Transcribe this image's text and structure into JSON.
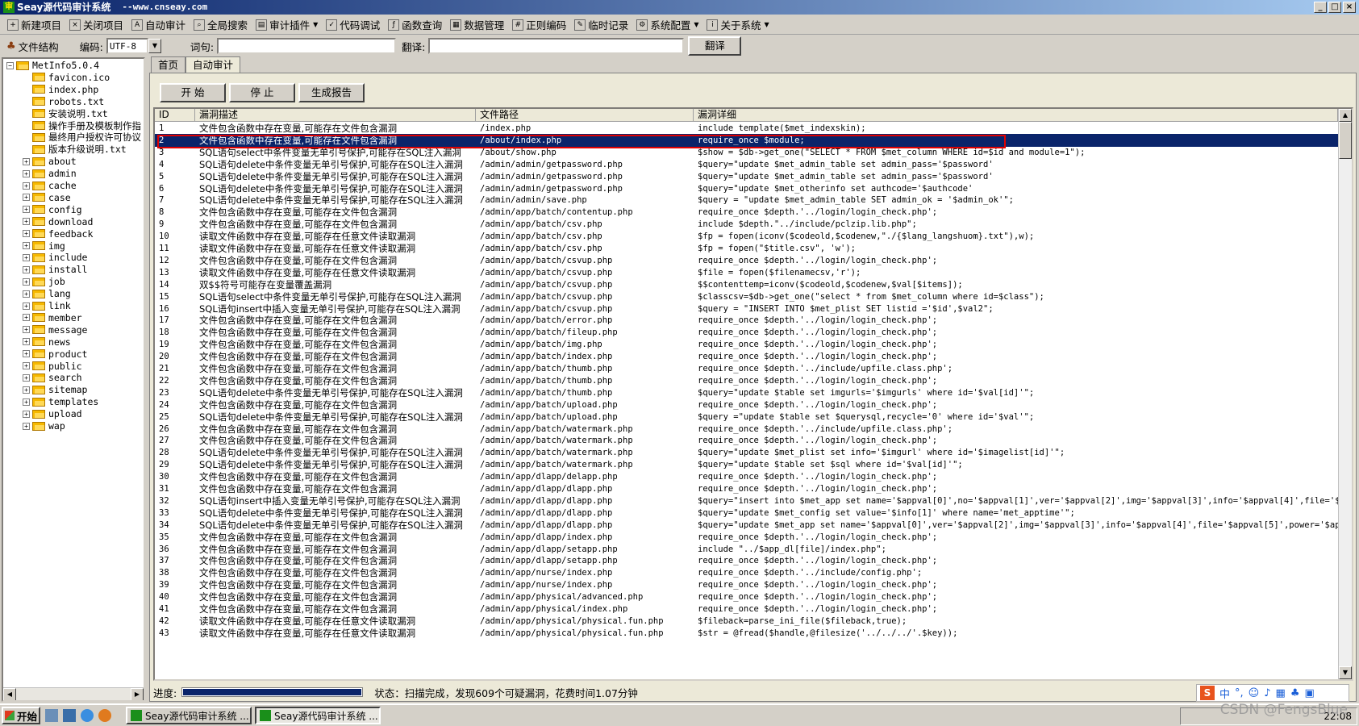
{
  "window": {
    "title": "Seay源代码审计系统",
    "subtitle": "--www.cnseay.com"
  },
  "toolbar": [
    {
      "label": "新建项目",
      "icon": "new-project-icon"
    },
    {
      "label": "关闭项目",
      "icon": "close-project-icon"
    },
    {
      "label": "自动审计",
      "icon": "auto-audit-icon"
    },
    {
      "label": "全局搜索",
      "icon": "search-icon"
    },
    {
      "label": "审计插件",
      "icon": "plugin-icon",
      "dropdown": true
    },
    {
      "label": "代码调试",
      "icon": "debug-icon"
    },
    {
      "label": "函数查询",
      "icon": "function-query-icon"
    },
    {
      "label": "数据管理",
      "icon": "data-manage-icon"
    },
    {
      "label": "正则编码",
      "icon": "regex-icon"
    },
    {
      "label": "临时记录",
      "icon": "note-icon"
    },
    {
      "label": "系统配置",
      "icon": "gear-icon",
      "dropdown": true
    },
    {
      "label": "关于系统",
      "icon": "info-icon",
      "dropdown": true
    }
  ],
  "searchrow": {
    "file_structure_label": "文件结构",
    "encoding_label": "编码:",
    "encoding_value": "UTF-8",
    "word_label": "词句:",
    "word_value": "",
    "translate_label": "翻译:",
    "translate_value": "",
    "translate_button": "翻译"
  },
  "tree": {
    "root": "MetInfo5.0.4",
    "files": [
      "favicon.ico",
      "index.php",
      "robots.txt",
      "安装说明.txt",
      "操作手册及模板制作指",
      "最终用户授权许可协议",
      "版本升级说明.txt"
    ],
    "folders": [
      "about",
      "admin",
      "cache",
      "case",
      "config",
      "download",
      "feedback",
      "img",
      "include",
      "install",
      "job",
      "lang",
      "link",
      "member",
      "message",
      "news",
      "product",
      "public",
      "search",
      "sitemap",
      "templates",
      "upload",
      "wap"
    ]
  },
  "tabs": [
    "首页",
    "自动审计"
  ],
  "active_tab": 1,
  "actions": {
    "start": "开 始",
    "stop": "停 止",
    "report": "生成报告"
  },
  "table": {
    "headers": [
      "ID",
      "漏洞描述",
      "文件路径",
      "漏洞详细"
    ],
    "selected_row": 1,
    "rows": [
      [
        "1",
        "文件包含函数中存在变量,可能存在文件包含漏洞",
        "/index.php",
        "include template($met_indexskin);"
      ],
      [
        "2",
        "文件包含函数中存在变量,可能存在文件包含漏洞",
        "/about/index.php",
        "require_once $module;"
      ],
      [
        "3",
        "SQL语句select中条件变量无单引号保护,可能存在SQL注入漏洞",
        "/about/show.php",
        "$show = $db->get_one(\"SELECT * FROM $met_column WHERE id=$id and module=1\");"
      ],
      [
        "4",
        "SQL语句delete中条件变量无单引号保护,可能存在SQL注入漏洞",
        "/admin/admin/getpassword.php",
        "$query=\"update $met_admin_table set   admin_pass='$password'"
      ],
      [
        "5",
        "SQL语句delete中条件变量无单引号保护,可能存在SQL注入漏洞",
        "/admin/admin/getpassword.php",
        "$query=\"update $met_admin_table set   admin_pass='$password'"
      ],
      [
        "6",
        "SQL语句delete中条件变量无单引号保护,可能存在SQL注入漏洞",
        "/admin/admin/getpassword.php",
        "$query=\"update $met_otherinfo set   authcode='$authcode'"
      ],
      [
        "7",
        "SQL语句delete中条件变量无单引号保护,可能存在SQL注入漏洞",
        "/admin/admin/save.php",
        "$query = \"update $met_admin_table SET admin_ok = '$admin_ok'\";"
      ],
      [
        "8",
        "文件包含函数中存在变量,可能存在文件包含漏洞",
        "/admin/app/batch/contentup.php",
        "require_once $depth.'../login/login_check.php';"
      ],
      [
        "9",
        "文件包含函数中存在变量,可能存在文件包含漏洞",
        "/admin/app/batch/csv.php",
        "include $depth.\"../include/pclzip.lib.php\";"
      ],
      [
        "10",
        "读取文件函数中存在变量,可能存在任意文件读取漏洞",
        "/admin/app/batch/csv.php",
        "$fp = fopen(iconv($codeold,$codenew,\"./{$lang_langshuom}.txt\"),w);"
      ],
      [
        "11",
        "读取文件函数中存在变量,可能存在任意文件读取漏洞",
        "/admin/app/batch/csv.php",
        "$fp = fopen(\"$title.csv\", 'w');"
      ],
      [
        "12",
        "文件包含函数中存在变量,可能存在文件包含漏洞",
        "/admin/app/batch/csvup.php",
        "require_once $depth.'../login/login_check.php';"
      ],
      [
        "13",
        "读取文件函数中存在变量,可能存在任意文件读取漏洞",
        "/admin/app/batch/csvup.php",
        "$file = fopen($filenamecsv,'r');"
      ],
      [
        "14",
        "双$$符号可能存在变量覆盖漏洞",
        "/admin/app/batch/csvup.php",
        "$$contenttemp=iconv($codeold,$codenew,$val[$items]);"
      ],
      [
        "15",
        "SQL语句select中条件变量无单引号保护,可能存在SQL注入漏洞",
        "/admin/app/batch/csvup.php",
        "$classcsv=$db->get_one(\"select * from $met_column where id=$class\");"
      ],
      [
        "16",
        "SQL语句insert中插入变量无单引号保护,可能存在SQL注入漏洞",
        "/admin/app/batch/csvup.php",
        "$query = \"INSERT INTO $met_plist SET listid ='$id',$val2\";"
      ],
      [
        "17",
        "文件包含函数中存在变量,可能存在文件包含漏洞",
        "/admin/app/batch/error.php",
        "require_once $depth.'../login/login_check.php';"
      ],
      [
        "18",
        "文件包含函数中存在变量,可能存在文件包含漏洞",
        "/admin/app/batch/fileup.php",
        "require_once $depth.'../login/login_check.php';"
      ],
      [
        "19",
        "文件包含函数中存在变量,可能存在文件包含漏洞",
        "/admin/app/batch/img.php",
        "require_once $depth.'../login/login_check.php';"
      ],
      [
        "20",
        "文件包含函数中存在变量,可能存在文件包含漏洞",
        "/admin/app/batch/index.php",
        "require_once $depth.'../login/login_check.php';"
      ],
      [
        "21",
        "文件包含函数中存在变量,可能存在文件包含漏洞",
        "/admin/app/batch/thumb.php",
        "require_once $depth.'../include/upfile.class.php';"
      ],
      [
        "22",
        "文件包含函数中存在变量,可能存在文件包含漏洞",
        "/admin/app/batch/thumb.php",
        "require_once $depth.'../login/login_check.php';"
      ],
      [
        "23",
        "SQL语句delete中条件变量无单引号保护,可能存在SQL注入漏洞",
        "/admin/app/batch/thumb.php",
        "$query=\"update $table set imgurls='$imgurls' where id='$val[id]'\";"
      ],
      [
        "24",
        "文件包含函数中存在变量,可能存在文件包含漏洞",
        "/admin/app/batch/upload.php",
        "require_once $depth.'../login/login_check.php';"
      ],
      [
        "25",
        "SQL语句delete中条件变量无单引号保护,可能存在SQL注入漏洞",
        "/admin/app/batch/upload.php",
        "$query =\"update $table set $querysql,recycle='0' where id='$val'\";"
      ],
      [
        "26",
        "文件包含函数中存在变量,可能存在文件包含漏洞",
        "/admin/app/batch/watermark.php",
        "require_once $depth.'../include/upfile.class.php';"
      ],
      [
        "27",
        "文件包含函数中存在变量,可能存在文件包含漏洞",
        "/admin/app/batch/watermark.php",
        "require_once $depth.'../login/login_check.php';"
      ],
      [
        "28",
        "SQL语句delete中条件变量无单引号保护,可能存在SQL注入漏洞",
        "/admin/app/batch/watermark.php",
        "$query=\"update $met_plist set info='$imgurl' where id='$imagelist[id]'\";"
      ],
      [
        "29",
        "SQL语句delete中条件变量无单引号保护,可能存在SQL注入漏洞",
        "/admin/app/batch/watermark.php",
        "$query=\"update $table set $sql where id='$val[id]'\";"
      ],
      [
        "30",
        "文件包含函数中存在变量,可能存在文件包含漏洞",
        "/admin/app/dlapp/delapp.php",
        "require_once $depth.'../login/login_check.php';"
      ],
      [
        "31",
        "文件包含函数中存在变量,可能存在文件包含漏洞",
        "/admin/app/dlapp/dlapp.php",
        "require_once $depth.'../login/login_check.php';"
      ],
      [
        "32",
        "SQL语句insert中插入变量无单引号保护,可能存在SQL注入漏洞",
        "/admin/app/dlapp/dlapp.php",
        "$query=\"insert into $met_app set name='$appval[0]',no='$appval[1]',ver='$appval[2]',img='$appval[3]',info='$appval[4]',file='$a..."
      ],
      [
        "33",
        "SQL语句delete中条件变量无单引号保护,可能存在SQL注入漏洞",
        "/admin/app/dlapp/dlapp.php",
        "$query=\"update $met_config set value='$info[1]' where name='met_apptime'\";"
      ],
      [
        "34",
        "SQL语句delete中条件变量无单引号保护,可能存在SQL注入漏洞",
        "/admin/app/dlapp/dlapp.php",
        "$query=\"update $met_app set name='$appval[0]',ver='$appval[2]',img='$appval[3]',info='$appval[4]',file='$appval[5]',power='$app..."
      ],
      [
        "35",
        "文件包含函数中存在变量,可能存在文件包含漏洞",
        "/admin/app/dlapp/index.php",
        "require_once $depth.'../login/login_check.php';"
      ],
      [
        "36",
        "文件包含函数中存在变量,可能存在文件包含漏洞",
        "/admin/app/dlapp/setapp.php",
        "include \"../$app_dl[file]/index.php\";"
      ],
      [
        "37",
        "文件包含函数中存在变量,可能存在文件包含漏洞",
        "/admin/app/dlapp/setapp.php",
        "require_once $depth.'../login/login_check.php';"
      ],
      [
        "38",
        "文件包含函数中存在变量,可能存在文件包含漏洞",
        "/admin/app/nurse/index.php",
        "require_once $depth.'../include/config.php';"
      ],
      [
        "39",
        "文件包含函数中存在变量,可能存在文件包含漏洞",
        "/admin/app/nurse/index.php",
        "require_once $depth.'../login/login_check.php';"
      ],
      [
        "40",
        "文件包含函数中存在变量,可能存在文件包含漏洞",
        "/admin/app/physical/advanced.php",
        "require_once $depth.'../login/login_check.php';"
      ],
      [
        "41",
        "文件包含函数中存在变量,可能存在文件包含漏洞",
        "/admin/app/physical/index.php",
        "require_once $depth.'../login/login_check.php';"
      ],
      [
        "42",
        "读取文件函数中存在变量,可能存在任意文件读取漏洞",
        "/admin/app/physical/physical.fun.php",
        "$fileback=parse_ini_file($fileback,true);"
      ],
      [
        "43",
        "读取文件函数中存在变量,可能存在任意文件读取漏洞",
        "/admin/app/physical/physical.fun.php",
        "$str = @fread($handle,@filesize('../../../'.$key));"
      ]
    ]
  },
  "status": {
    "progress_label": "进度:",
    "progress_value": 1.0,
    "status_text": "状态：扫描完成，发现609个可疑漏洞，花费时间1.07分钟"
  },
  "taskbar": {
    "start_label": "开始",
    "tasks": [
      "Seay源代码审计系统 ...",
      "Seay源代码审计系统 ..."
    ],
    "active_task": 1,
    "clock": "22:08"
  },
  "ime": {
    "logo": "S",
    "mode": "中"
  },
  "watermark": "CSDN @FengsBlue"
}
